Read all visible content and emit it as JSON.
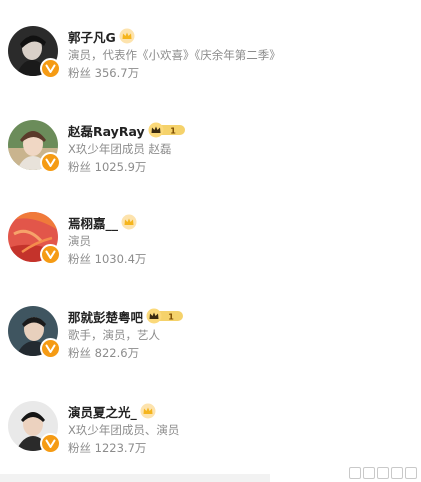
{
  "users": [
    {
      "name": "郭子凡G",
      "desc": "演员，代表作《小欢喜》《庆余年第二季》",
      "fans_label": "粉丝",
      "fans": "356.7万",
      "level": ""
    },
    {
      "name": "赵磊RayRay",
      "desc": "X玖少年团成员 赵磊",
      "fans_label": "粉丝",
      "fans": "1025.9万",
      "level": "1"
    },
    {
      "name": "焉栩嘉__",
      "desc": "演员",
      "fans_label": "粉丝",
      "fans": "1030.4万",
      "level": ""
    },
    {
      "name": "那就彭楚粤吧",
      "desc": "歌手，演员，艺人",
      "fans_label": "粉丝",
      "fans": "822.6万",
      "level": "1"
    },
    {
      "name": "演员夏之光_",
      "desc": "X玖少年团成员、演员",
      "fans_label": "粉丝",
      "fans": "1223.7万",
      "level": ""
    }
  ],
  "colors": {
    "verified_badge": "#f59b14",
    "crown_gold": "#f5b51c",
    "name_text": "#222222",
    "secondary_text": "#8c8c8c"
  },
  "icons": {
    "verified": "verified-v-icon",
    "crown": "vip-crown-icon"
  }
}
